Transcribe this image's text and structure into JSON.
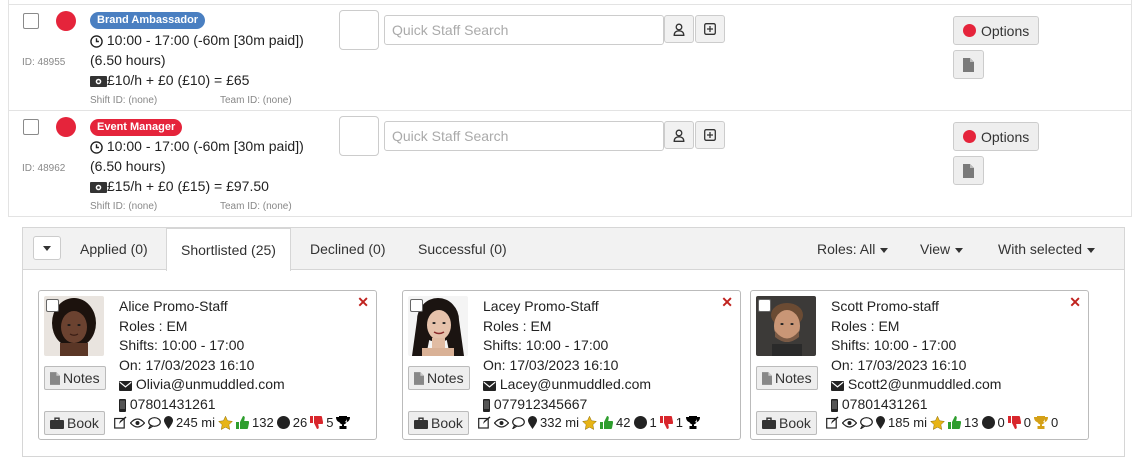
{
  "rows": [
    {
      "role_badge": "Brand Ambassador",
      "role_color": "#4a7fc1",
      "time": "10:00 - 17:00 (-60m [30m paid])",
      "hours": "(6.50 hours)",
      "pay": "£10/h + £0 (£10) = £65",
      "id": "ID: 48955",
      "shift_id": "Shift ID: (none)",
      "team_id": "Team ID: (none)",
      "search_placeholder": "Quick Staff Search",
      "options_label": "Options"
    },
    {
      "role_badge": "Event Manager",
      "role_color": "#e5243b",
      "time": "10:00 - 17:00 (-60m [30m paid])",
      "hours": "(6.50 hours)",
      "pay": "£15/h + £0 (£15) = £97.50",
      "id": "ID: 48962",
      "shift_id": "Shift ID: (none)",
      "team_id": "Team ID: (none)",
      "search_placeholder": "Quick Staff Search",
      "options_label": "Options"
    }
  ],
  "tabs": {
    "applied": "Applied (0)",
    "shortlisted": "Shortlisted (25)",
    "declined": "Declined (0)",
    "successful": "Successful (0)",
    "roles": "Roles: All",
    "view": "View",
    "with_selected": "With selected"
  },
  "cards": [
    {
      "name": "Alice Promo-Staff",
      "roles": "Roles : EM",
      "shifts": "Shifts: 10:00 - 17:00",
      "on": "On: 17/03/2023 16:10",
      "email": "Olivia@unmuddled.com",
      "phone": "07801431261",
      "notes_label": "Notes",
      "book_label": "Book",
      "distance": "245 mi",
      "likes": "132",
      "neutral": "26",
      "dislikes": "5",
      "trophy_count": "",
      "thumb_color": "#2e9e2e",
      "trophy_color": "#000000"
    },
    {
      "name": "Lacey Promo-Staff",
      "roles": "Roles : EM",
      "shifts": "Shifts: 10:00 - 17:00",
      "on": "On: 17/03/2023 16:10",
      "email": "Lacey@unmuddled.com",
      "phone": "077912345667",
      "notes_label": "Notes",
      "book_label": "Book",
      "distance": "332 mi",
      "likes": "42",
      "neutral": "1",
      "dislikes": "1",
      "trophy_count": "",
      "thumb_color": "#2e9e2e",
      "trophy_color": "#000000"
    },
    {
      "name": "Scott Promo-staff",
      "roles": "Roles : EM",
      "shifts": "Shifts: 10:00 - 17:00",
      "on": "On: 17/03/2023 16:10",
      "email": "Scott2@unmuddled.com",
      "phone": "07801431261",
      "notes_label": "Notes",
      "book_label": "Book",
      "distance": "185 mi",
      "likes": "13",
      "neutral": "0",
      "dislikes": "0",
      "trophy_count": "0",
      "thumb_color": "#2e9e2e",
      "trophy_color": "#d4a017"
    }
  ]
}
